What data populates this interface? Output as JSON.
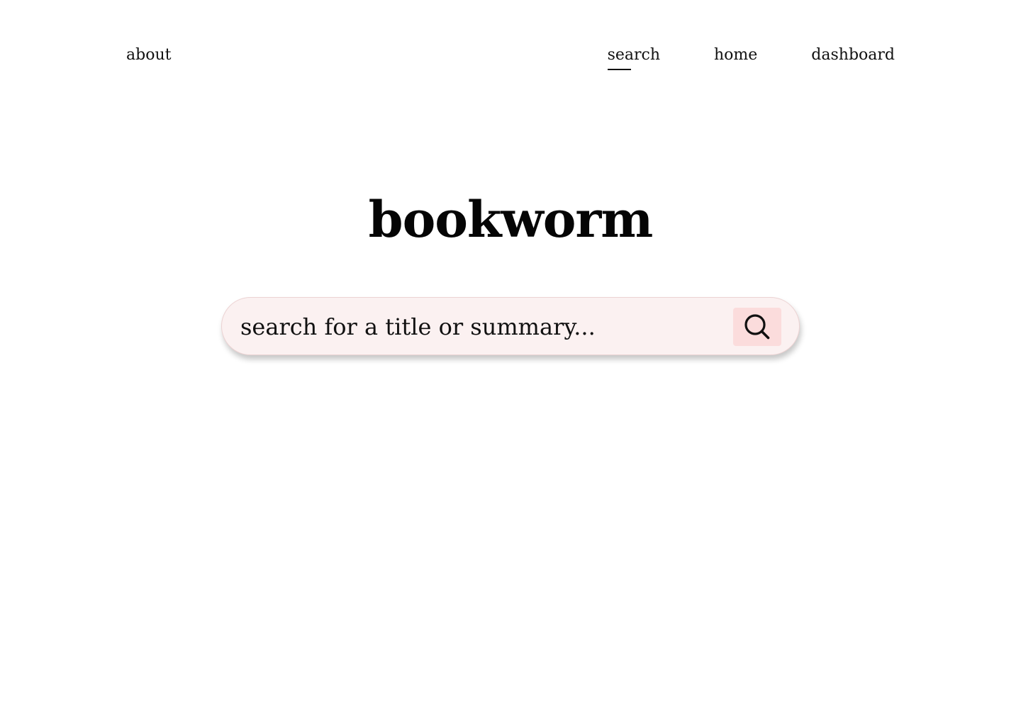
{
  "nav": {
    "left": [
      {
        "label": "about"
      }
    ],
    "right": [
      {
        "label": "search",
        "active": true
      },
      {
        "label": "home"
      },
      {
        "label": "dashboard"
      }
    ]
  },
  "hero": {
    "title": "bookworm"
  },
  "search": {
    "placeholder": "search for a title or summary...",
    "value": "",
    "button_icon": "search-icon"
  },
  "colors": {
    "search_bar_bg": "#fbf1f1",
    "search_button_bg": "#fbdcdc",
    "text": "#111111"
  }
}
